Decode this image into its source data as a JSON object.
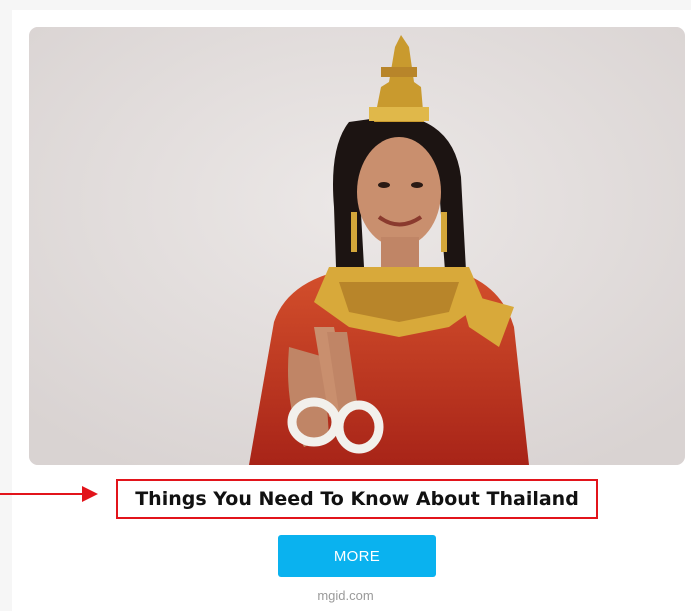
{
  "ad": {
    "image_icon": "thai-dancer-photo",
    "headline": "Things You Need To Know About Thailand",
    "cta_label": "MORE",
    "source": "mgid.com"
  },
  "colors": {
    "highlight_border": "#e2141b",
    "cta_background": "#0ab2ef",
    "source_text": "#9a9a9a"
  }
}
